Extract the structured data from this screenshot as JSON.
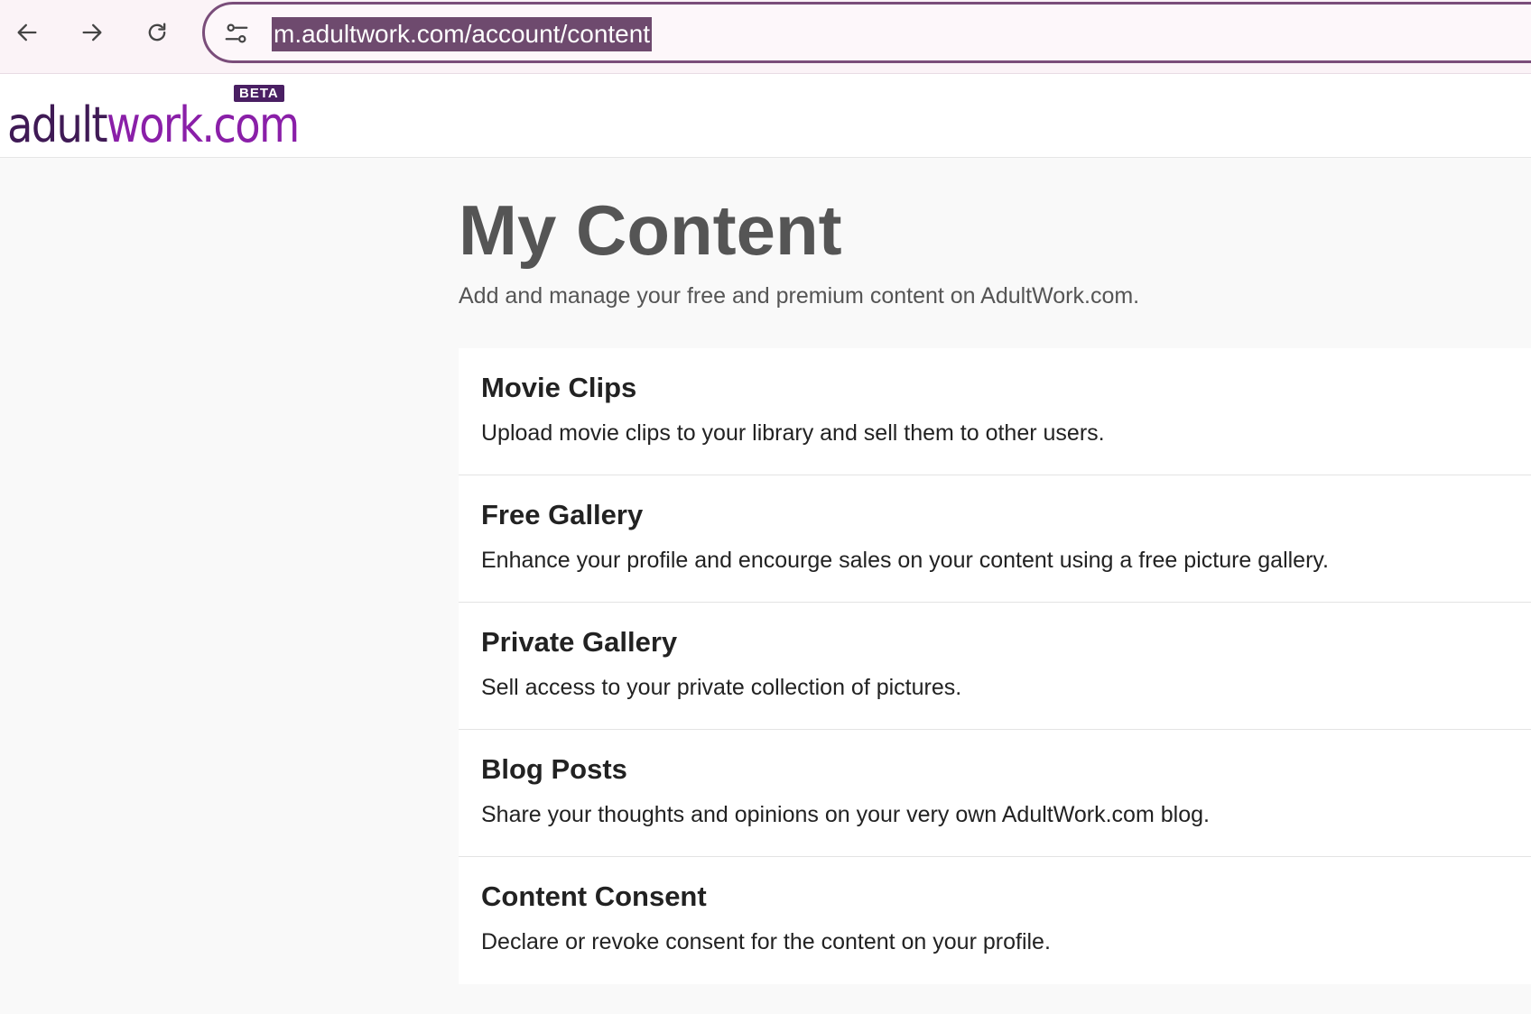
{
  "browser": {
    "url": "m.adultwork.com/account/content",
    "nav": {
      "back_icon": "arrow-left-icon",
      "forward_icon": "arrow-right-icon",
      "reload_icon": "reload-icon",
      "site_info_icon": "tune-icon"
    },
    "accent_color": "#7a4d7a"
  },
  "header": {
    "logo_part1": "adult",
    "logo_part2": "work.com",
    "badge": "BETA",
    "logo_colors": [
      "#3f1a55",
      "#8a1fa8"
    ]
  },
  "main": {
    "title": "My Content",
    "subtitle": "Add and manage your free and premium content on AdultWork.com.",
    "items": [
      {
        "title": "Movie Clips",
        "description": "Upload movie clips to your library and sell them to other users."
      },
      {
        "title": "Free Gallery",
        "description": "Enhance your profile and encourge sales on your content using a free picture gallery."
      },
      {
        "title": "Private Gallery",
        "description": "Sell access to your private collection of pictures."
      },
      {
        "title": "Blog Posts",
        "description": "Share your thoughts and opinions on your very own AdultWork.com blog."
      },
      {
        "title": "Content Consent",
        "description": "Declare or revoke consent for the content on your profile."
      }
    ]
  }
}
